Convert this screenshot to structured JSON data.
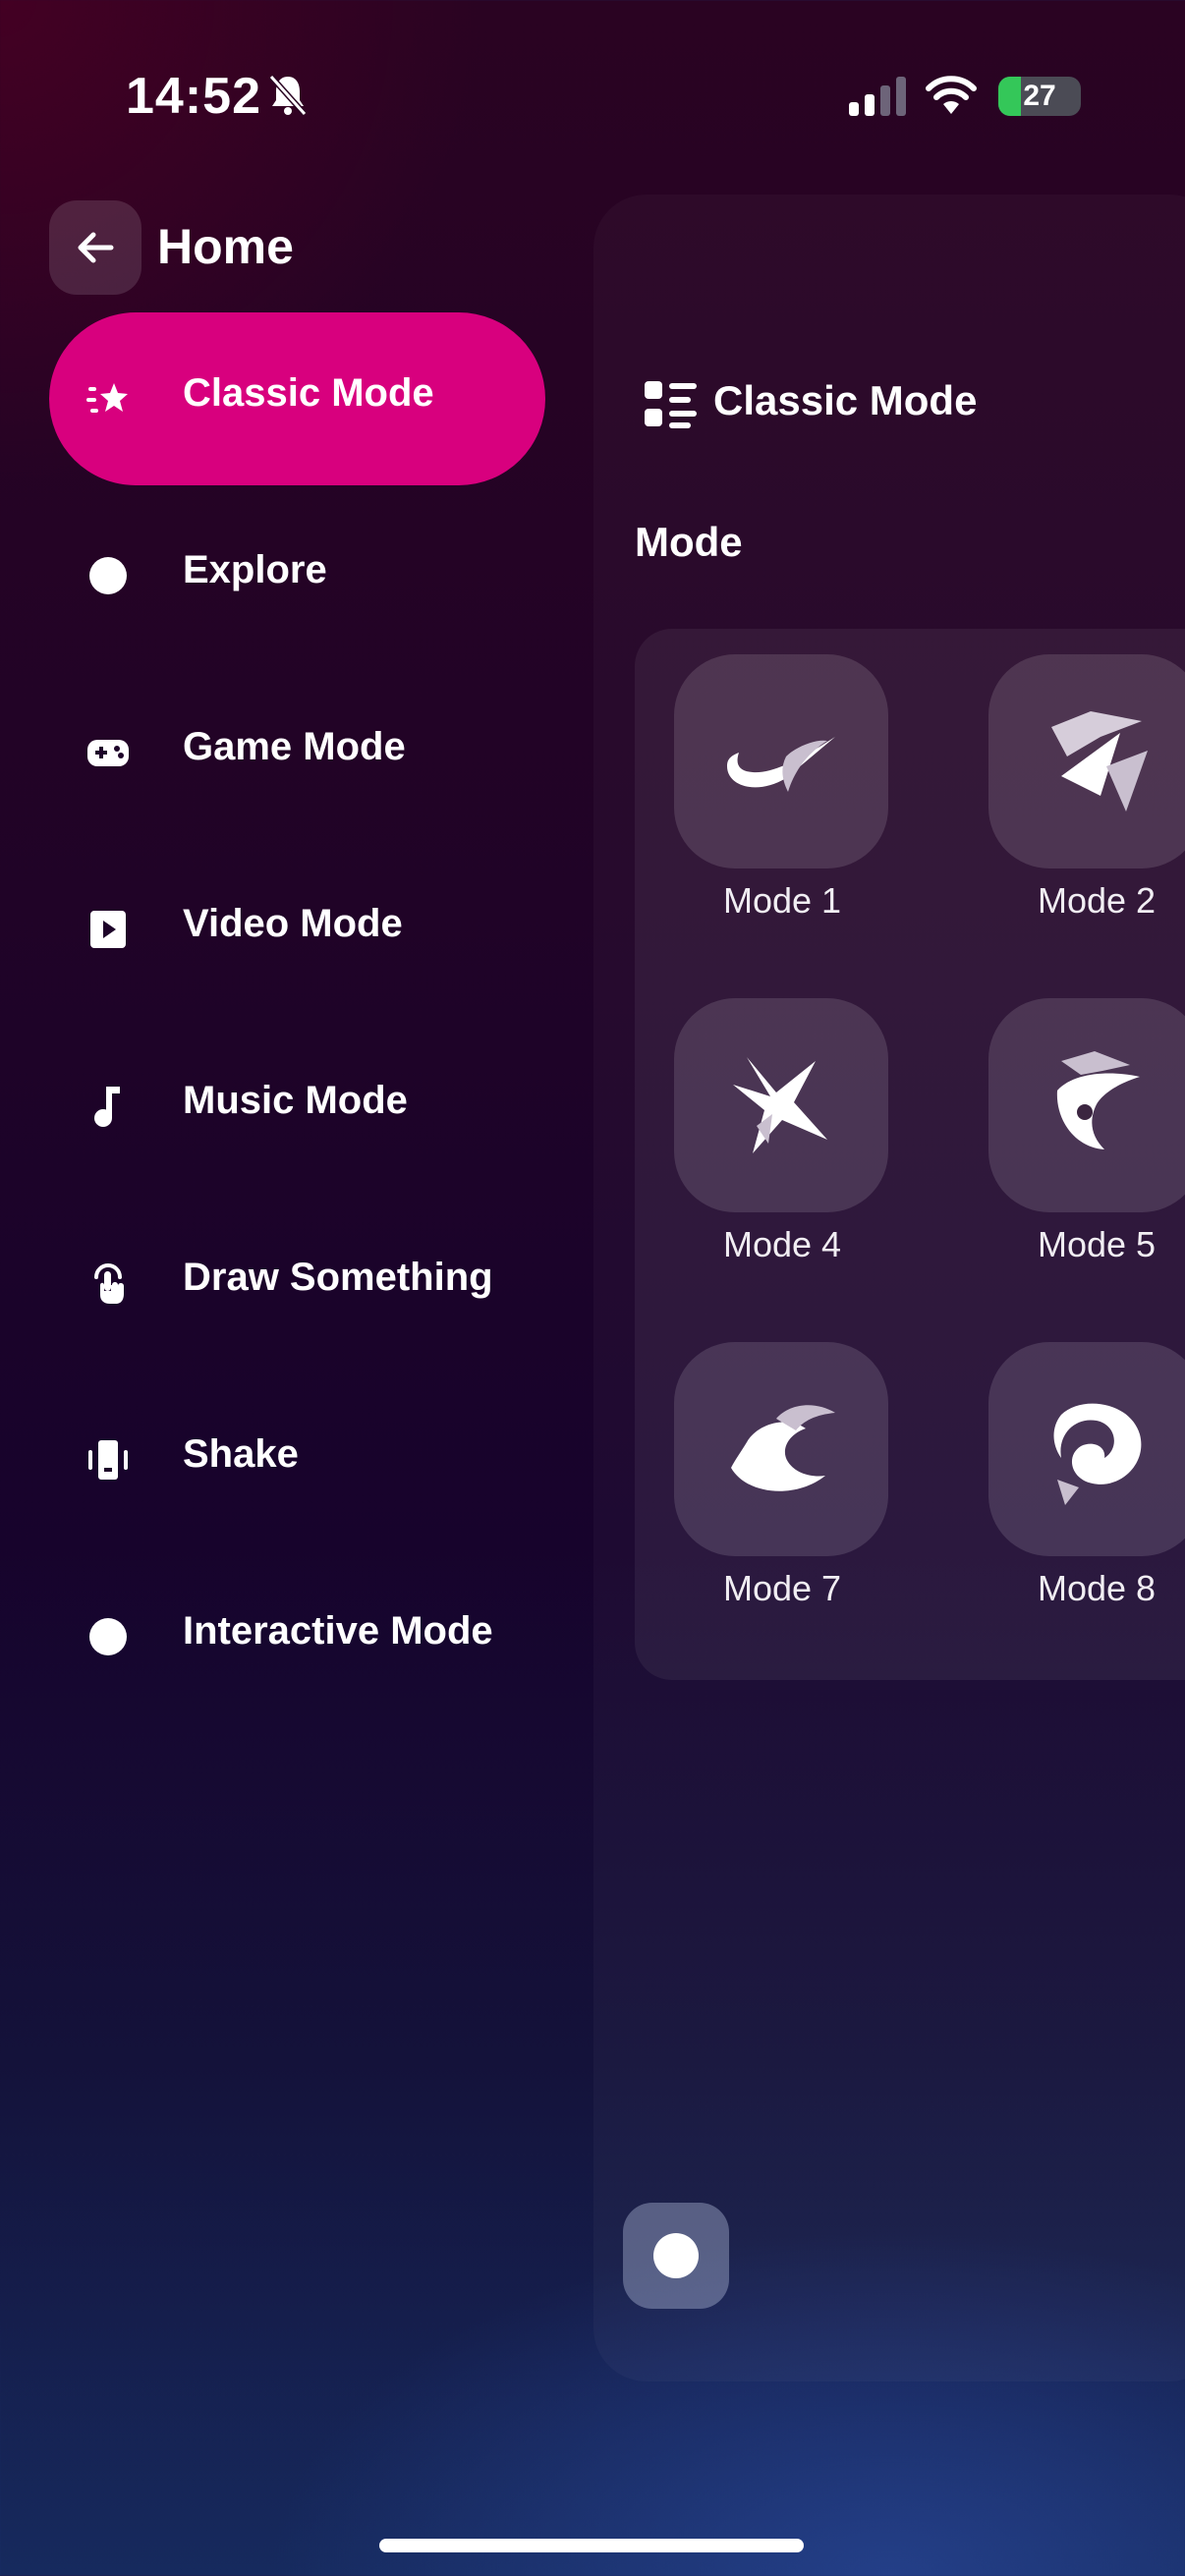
{
  "status_bar": {
    "time": "14:52",
    "battery": "27"
  },
  "header": {
    "title": "Home"
  },
  "sidebar": {
    "items": [
      {
        "label": "Classic Mode",
        "icon": "star-lines-icon",
        "active": true
      },
      {
        "label": "Explore",
        "icon": "dot-icon"
      },
      {
        "label": "Game Mode",
        "icon": "gamepad-icon"
      },
      {
        "label": "Video Mode",
        "icon": "play-icon"
      },
      {
        "label": "Music Mode",
        "icon": "music-note-icon"
      },
      {
        "label": "Draw Something",
        "icon": "hand-touch-icon"
      },
      {
        "label": "Shake",
        "icon": "phone-shake-icon"
      },
      {
        "label": "Interactive Mode",
        "icon": "dot-icon"
      }
    ]
  },
  "panel": {
    "title": "Classic Mode",
    "section": "Mode",
    "tiles": [
      {
        "label": "Mode 1"
      },
      {
        "label": "Mode 2"
      },
      {
        "label": "Mode 4"
      },
      {
        "label": "Mode 5"
      },
      {
        "label": "Mode 7"
      },
      {
        "label": "Mode 8"
      }
    ]
  },
  "colors": {
    "accent": "#d8007e",
    "battery": "#34c759"
  }
}
